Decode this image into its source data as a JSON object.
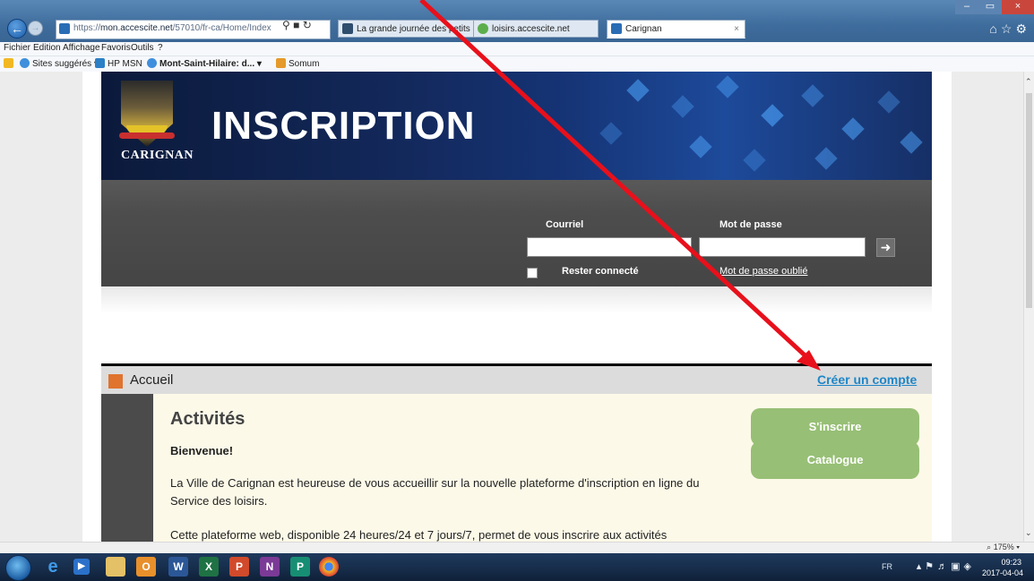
{
  "browser": {
    "url_prefix": "https://",
    "url_host": "mon.accescite.net",
    "url_path": "/57010/fr-ca/Home/Index",
    "tabs": [
      {
        "label": "La grande journée des petits e..."
      },
      {
        "label": "loisirs.accescite.net"
      },
      {
        "label": "Carignan"
      }
    ],
    "menu": [
      "Fichier",
      "Edition",
      "Affichage",
      "Favoris",
      "Outils",
      "?"
    ],
    "favorites": [
      "Sites suggérés ▾",
      "HP MSN",
      "Mont-Saint-Hilaire: d...  ▾",
      "Somum"
    ],
    "zoom": "175%"
  },
  "page": {
    "brand_name": "CARIGNAN",
    "brand_title": "INSCRIPTION",
    "login": {
      "email_label": "Courriel",
      "password_label": "Mot de passe",
      "remember_label": "Rester connecté",
      "forgot_label": "Mot de passe oublié"
    },
    "crumb": "Accueil",
    "create_account": "Créer un compte",
    "content": {
      "title": "Activités",
      "welcome": "Bienvenue!",
      "para1": "La Ville de Carignan est heureuse de vous accueillir sur la nouvelle plateforme d'inscription en ligne du Service des loisirs.",
      "para2": "Cette plateforme web, disponible 24 heures/24 et 7 jours/7, permet de vous inscrire aux activités"
    },
    "buttons": {
      "register": "S'inscrire",
      "catalog": "Catalogue"
    }
  },
  "taskbar": {
    "lang": "FR",
    "time": "09:23",
    "date": "2017-04-04"
  },
  "colors": {
    "accent_green": "#97bf75",
    "link_blue": "#1f86c7",
    "arrow_red": "#e8101b",
    "crumb_orange": "#e0732e"
  }
}
